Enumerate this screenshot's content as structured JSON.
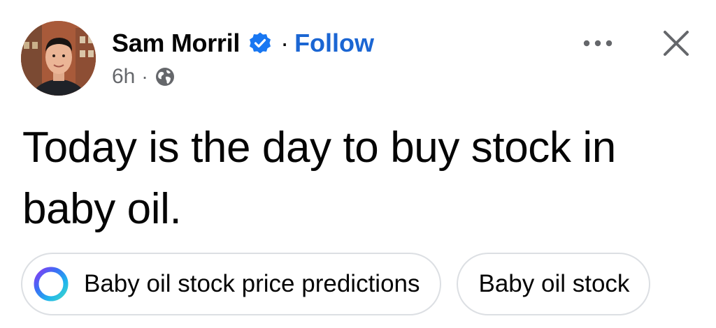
{
  "post": {
    "author": {
      "name": "Sam Morril",
      "verified": true,
      "follow_label": "Follow",
      "separator": "·"
    },
    "meta": {
      "time": "6h",
      "separator": "·",
      "audience_icon": "globe-icon"
    },
    "actions": {
      "more_icon": "more-dots-icon",
      "close_icon": "close-icon"
    },
    "text": "Today is the day to buy stock in baby oil."
  },
  "suggestions": [
    {
      "label": "Baby oil stock price predictions",
      "icon": "meta-ai-icon"
    },
    {
      "label": "Baby oil stock"
    }
  ],
  "colors": {
    "follow_blue": "#1b66d3",
    "verified_blue": "#1877f2",
    "meta_gray": "#65676b",
    "chip_border": "#dcdfe3"
  }
}
